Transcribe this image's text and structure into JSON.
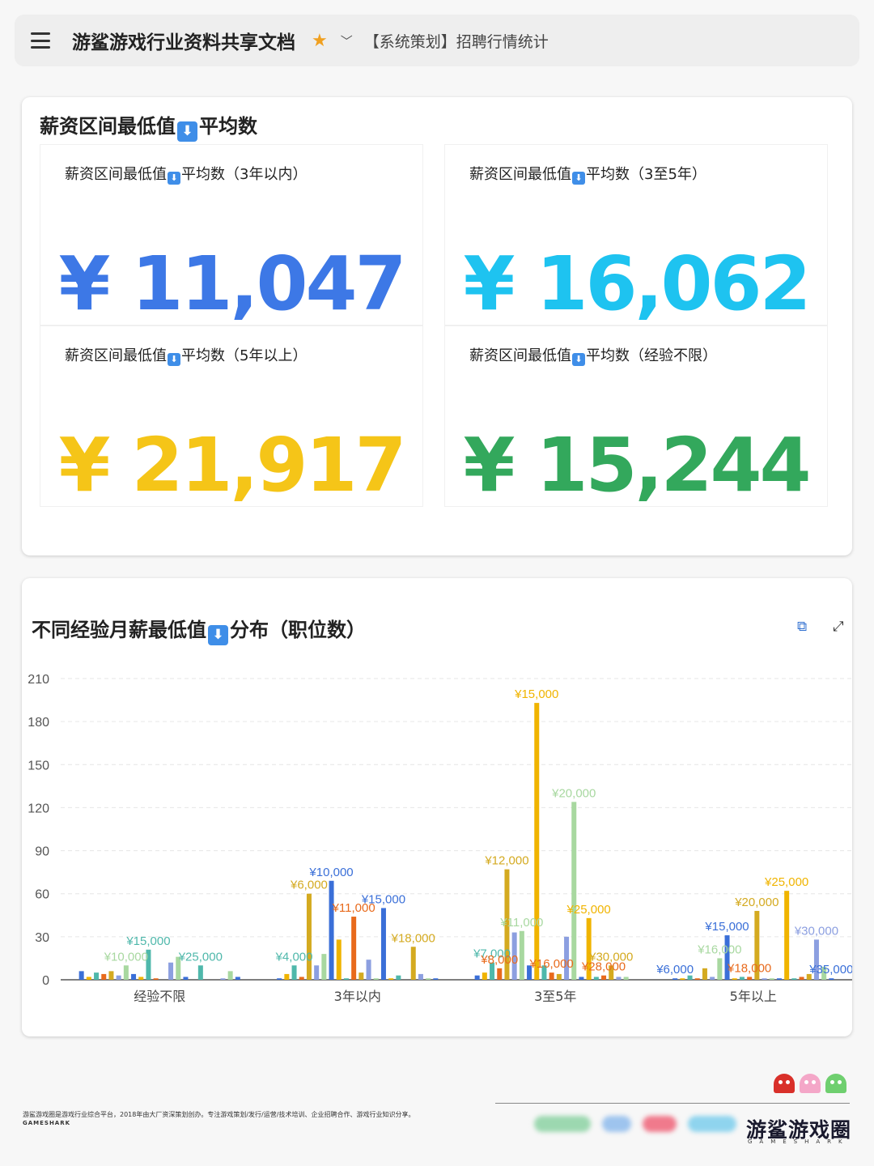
{
  "topbar": {
    "doc_title": "游鲨游戏行业资料共享文档",
    "sheet_title": "【系统策划】招聘行情统计",
    "icons": [
      "menu-icon",
      "star-icon",
      "chevron-down-icon"
    ]
  },
  "kpi_section": {
    "title_pre": "薪资区间最低值",
    "title_post": "平均数",
    "icon_glyph": "⬇",
    "cards": [
      {
        "label_pre": "薪资区间最低值",
        "label_post": "平均数（3年以内）",
        "value": "¥ 11,047",
        "color": "#3d78e6"
      },
      {
        "label_pre": "薪资区间最低值",
        "label_post": "平均数（3至5年）",
        "value": "¥ 16,062",
        "color": "#1ec3f0"
      },
      {
        "label_pre": "薪资区间最低值",
        "label_post": "平均数（5年以上）",
        "value": "¥ 21,917",
        "color": "#f5c518"
      },
      {
        "label_pre": "薪资区间最低值",
        "label_post": "平均数（经验不限）",
        "value": "¥ 15,244",
        "color": "#33a85c"
      }
    ]
  },
  "chart_section": {
    "title_pre": "不同经验月薪最低值",
    "title_post": "分布（职位数）",
    "icon_glyph": "⬇",
    "tools": [
      "copy-icon",
      "fullscreen-icon"
    ]
  },
  "chart_data": {
    "type": "bar",
    "categories": [
      "经验不限",
      "3年以内",
      "3至5年",
      "5年以上"
    ],
    "ylim": [
      0,
      210
    ],
    "yticks": [
      0,
      30,
      60,
      90,
      120,
      150,
      180,
      210
    ],
    "grid": true,
    "colors": [
      "#3a6fd8",
      "#f0b400",
      "#4fb8ab",
      "#e86a1c",
      "#d4aa20",
      "#8c9fe0",
      "#a8d8a0"
    ],
    "groups": [
      {
        "category": "经验不限",
        "bars": [
          6,
          2,
          5,
          4,
          6,
          3,
          10,
          4,
          2,
          21,
          1,
          0,
          12,
          16,
          2,
          0,
          10,
          0,
          0,
          1,
          6,
          2
        ],
        "labels": [
          {
            "bar": 6,
            "text": "¥10,000"
          },
          {
            "bar": 9,
            "text": "¥15,000"
          },
          {
            "bar": 16,
            "text": "¥25,000"
          }
        ]
      },
      {
        "category": "3年以内",
        "bars": [
          1,
          4,
          10,
          2,
          60,
          10,
          18,
          69,
          28,
          1,
          44,
          5,
          14,
          1,
          50,
          1,
          3,
          0,
          23,
          4,
          1,
          1
        ],
        "labels": [
          {
            "bar": 2,
            "text": "¥4,000"
          },
          {
            "bar": 4,
            "text": "¥6,000"
          },
          {
            "bar": 7,
            "text": "¥10,000"
          },
          {
            "bar": 10,
            "text": "¥11,000"
          },
          {
            "bar": 14,
            "text": "¥15,000"
          },
          {
            "bar": 18,
            "text": "¥18,000"
          }
        ]
      },
      {
        "category": "3至5年",
        "bars": [
          3,
          5,
          12,
          8,
          77,
          33,
          34,
          10,
          193,
          10,
          5,
          4,
          30,
          124,
          2,
          43,
          2,
          3,
          10,
          2,
          2,
          0
        ],
        "labels": [
          {
            "bar": 2,
            "text": "¥7,000"
          },
          {
            "bar": 3,
            "text": "¥8,000"
          },
          {
            "bar": 6,
            "text": "¥11,000"
          },
          {
            "bar": 4,
            "text": "¥12,000"
          },
          {
            "bar": 8,
            "text": "¥15,000"
          },
          {
            "bar": 10,
            "text": "¥16,000"
          },
          {
            "bar": 13,
            "text": "¥20,000"
          },
          {
            "bar": 15,
            "text": "¥25,000"
          },
          {
            "bar": 17,
            "text": "¥28,000"
          },
          {
            "bar": 18,
            "text": "¥30,000"
          }
        ]
      },
      {
        "category": "5年以上",
        "bars": [
          1,
          1,
          3,
          1,
          8,
          2,
          15,
          31,
          1,
          2,
          2,
          48,
          1,
          1,
          1,
          62,
          1,
          2,
          4,
          28,
          9,
          1
        ],
        "labels": [
          {
            "bar": 0,
            "text": "¥6,000"
          },
          {
            "bar": 6,
            "text": "¥16,000"
          },
          {
            "bar": 7,
            "text": "¥15,000"
          },
          {
            "bar": 10,
            "text": "¥18,000"
          },
          {
            "bar": 11,
            "text": "¥20,000"
          },
          {
            "bar": 15,
            "text": "¥25,000"
          },
          {
            "bar": 19,
            "text": "¥30,000"
          },
          {
            "bar": 21,
            "text": "¥35,000"
          }
        ]
      }
    ]
  },
  "footer": {
    "description": "游鲨游戏圈是游戏行业综合平台，2018年由大厂资深策划创办。专注游戏策划/发行/运营/技术培训、企业招聘合作、游戏行业知识分享。",
    "sub": "GAMESHARK",
    "brand": "游鲨游戏圈",
    "brand_sub": "GAMESHARK",
    "ghost_colors": [
      "#d9302a",
      "#f4a7c8",
      "#6fcf6f"
    ]
  }
}
